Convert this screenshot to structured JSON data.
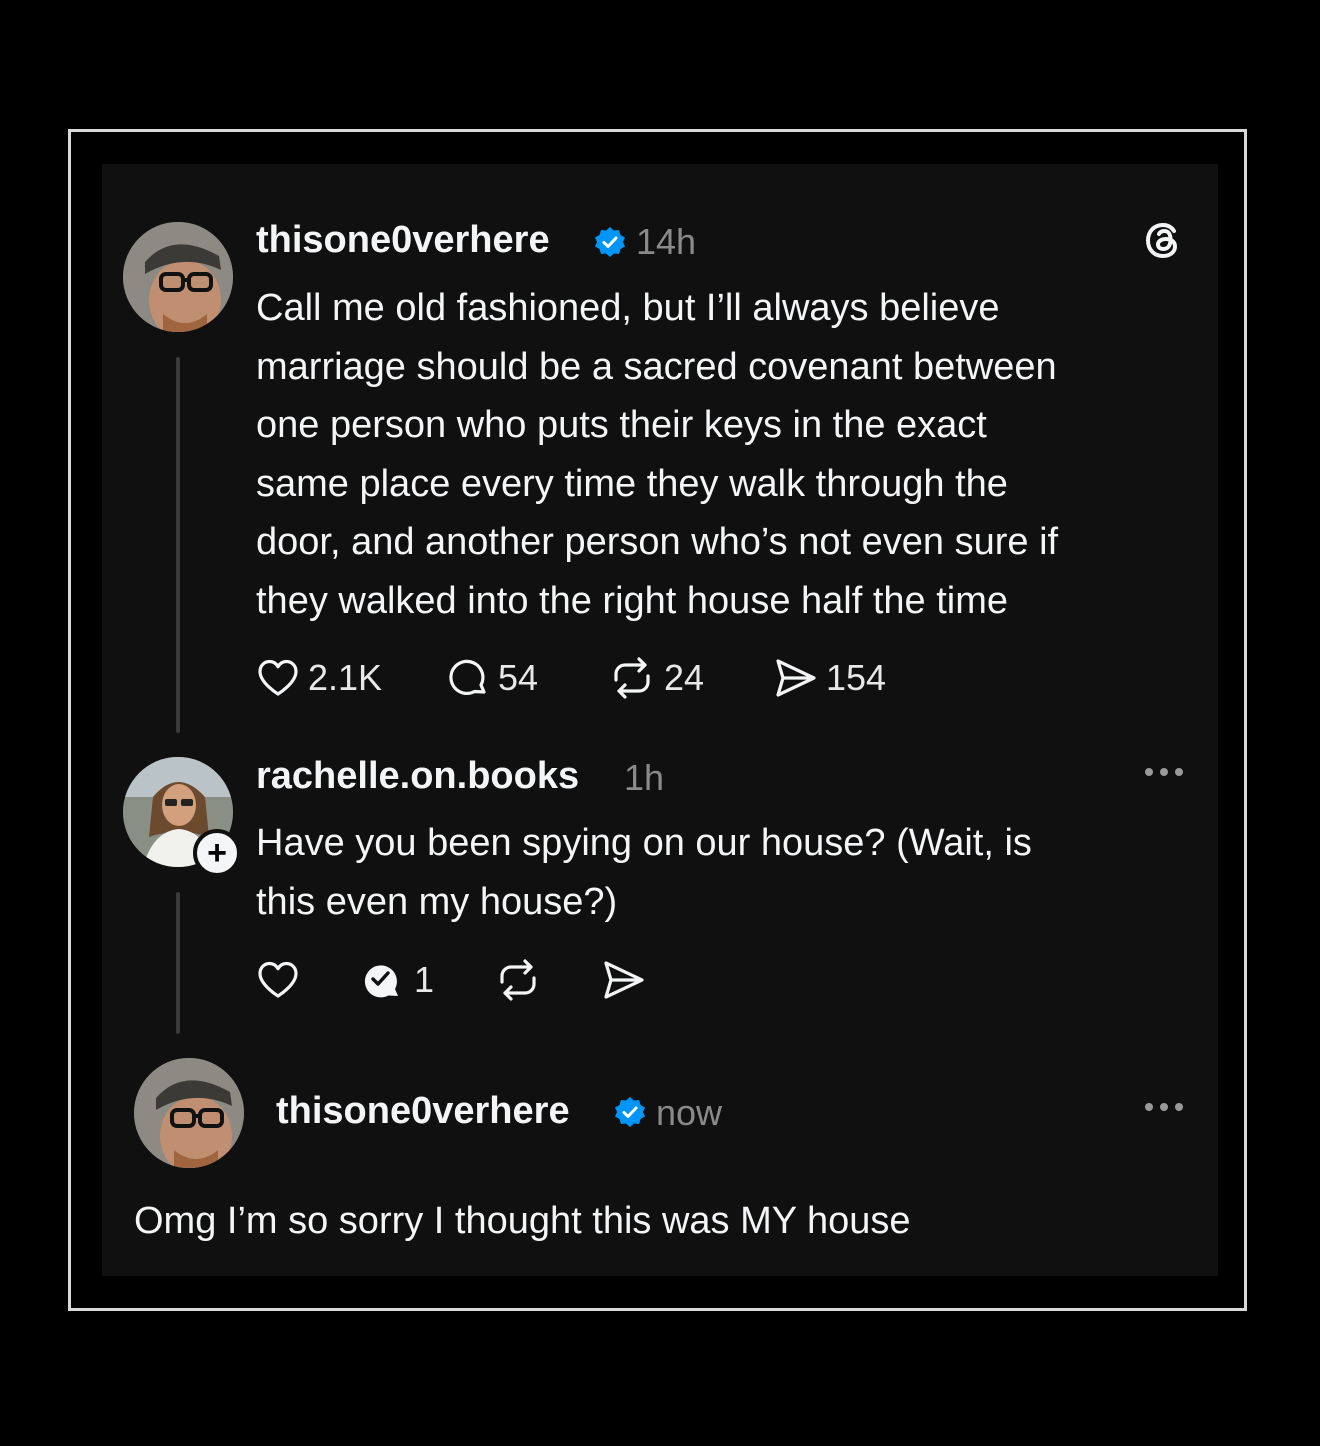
{
  "post": {
    "handle": "thisone0verhere",
    "time": "14h",
    "text": "Call me old fashioned, but I’ll always believe\nmarriage should be a sacred covenant between\none person who puts their keys in the exact\nsame place every time they walk through the\ndoor, and another person who’s not even sure if\nthey walked into the right house half the time",
    "likes": "2.1K",
    "replies": "54",
    "reposts": "24",
    "shares": "154"
  },
  "reply": {
    "handle": "rachelle.on.books",
    "time": "1h",
    "text": "Have you been spying on our house? (Wait, is\nthis even my house?)",
    "replies": "1"
  },
  "response": {
    "handle": "thisone0verhere",
    "time": "now",
    "text": "Omg I’m so sorry I thought this was MY house"
  },
  "colors": {
    "background": "#000000",
    "card": "#101010",
    "verified": "#0095f6",
    "muted": "#8a8a8a"
  },
  "icons": [
    "heart-icon",
    "comment-icon",
    "repost-icon",
    "share-icon",
    "verified-icon",
    "threads-logo-icon",
    "more-icon",
    "follow-plus-icon"
  ]
}
